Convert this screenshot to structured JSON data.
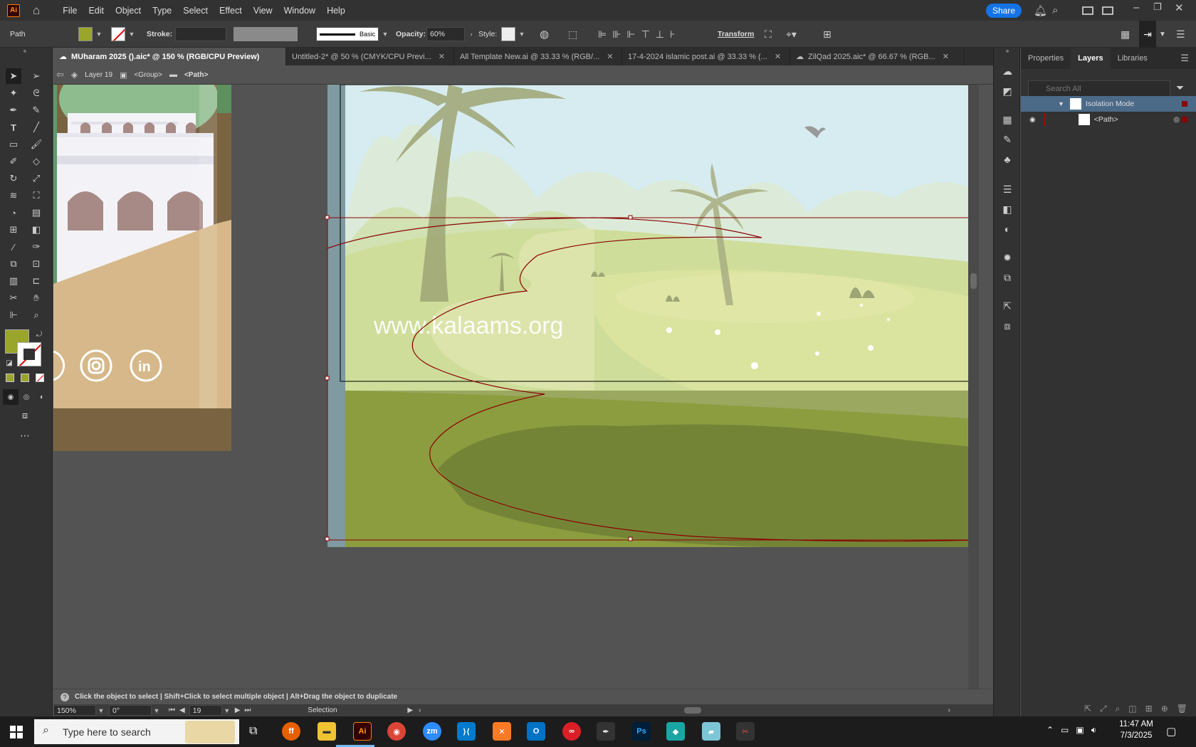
{
  "app": {
    "logo": "Ai",
    "menus": [
      "File",
      "Edit",
      "Object",
      "Type",
      "Select",
      "Effect",
      "View",
      "Window",
      "Help"
    ],
    "share_label": "Share"
  },
  "control": {
    "selection_type": "Path",
    "fill_color": "#9aa52c",
    "stroke_label": "Stroke:",
    "brush_label": "Basic",
    "opacity_label": "Opacity:",
    "opacity_value": "60%",
    "style_label": "Style:",
    "transform_label": "Transform"
  },
  "tabs": [
    {
      "label": "MUharam 2025 ().aic* @ 150 % (RGB/CPU Preview)"
    },
    {
      "label": "Untitled-2* @ 50 % (CMYK/CPU Previ..."
    },
    {
      "label": "All Template New.ai @ 33.33 % (RGB/..."
    },
    {
      "label": "17-4-2024 islamic post.ai @ 33.33 % (..."
    },
    {
      "label": "ZilQad 2025.aic* @ 66.67 % (RGB..."
    }
  ],
  "breadcrumb": {
    "layer": "Layer 19",
    "group": "<Group>",
    "path": "<Path>"
  },
  "artwork": {
    "website": "www.kalaams.org"
  },
  "panel": {
    "tabs": [
      "Properties",
      "Layers",
      "Libraries"
    ],
    "search_placeholder": "Search All",
    "rows": [
      {
        "label": "Isolation Mode"
      },
      {
        "label": "<Path>"
      }
    ]
  },
  "status": {
    "hint": "Click the object to select  |  Shift+Click to select multiple object  |  Alt+Drag the object to duplicate",
    "zoom": "150%",
    "rotation": "0°",
    "artboard": "19",
    "mode": "Selection"
  },
  "taskbar": {
    "search_placeholder": "Type here to search",
    "time": "11:47 AM",
    "date": "7/3/2025"
  }
}
